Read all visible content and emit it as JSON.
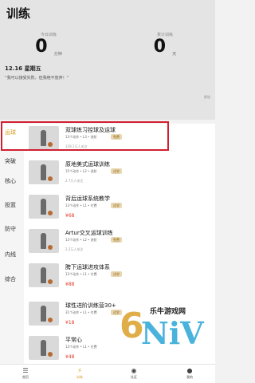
{
  "header": {
    "title": "训练"
  },
  "stats": {
    "today": {
      "label": "今日训练",
      "value": "0",
      "unit": "分钟"
    },
    "total": {
      "label": "累计训练",
      "value": "0",
      "unit": "天"
    }
  },
  "date": "12.16 星期五",
  "quote": "“我可以接受失败，但我绝不放弃！”",
  "lock_text": "解锁",
  "sidebar": {
    "items": [
      {
        "label": "运球",
        "active": true
      },
      {
        "label": "突破"
      },
      {
        "label": "核心"
      },
      {
        "label": "投篮"
      },
      {
        "label": "防守"
      },
      {
        "label": "内线"
      },
      {
        "label": "综合"
      }
    ]
  },
  "courses": [
    {
      "title": "双球练习控球及运球",
      "meta": "13个动作 • L3 • 进阶",
      "tag": "免费",
      "extra": "129.1万人关注"
    },
    {
      "title": "原地美式运球训练",
      "meta": "15个动作 • L2 • 进阶",
      "tag": "试学",
      "extra": "2.7万人关注"
    },
    {
      "title": "背后运球系统教学",
      "meta": "13个动作 • L1 • 付费",
      "tag": "试学",
      "extra": "¥68"
    },
    {
      "title": "Artur交叉运球训练",
      "meta": "13个动作 • L2 • 进阶",
      "tag": "免费",
      "extra": "2.2万人关注"
    },
    {
      "title": "胯下运球进攻体系",
      "meta": "13个动作 • L1 • 付费",
      "tag": "试学",
      "extra": "¥88"
    },
    {
      "title": "球性进阶训练营30+",
      "meta": "31个动作 • L1 • 付费",
      "tag": "试学",
      "extra": "¥18"
    },
    {
      "title": "平常心",
      "meta": "13个动作 • L1 • 付费",
      "tag": "",
      "extra": "¥48"
    }
  ],
  "tabbar": [
    {
      "label": "首页",
      "icon": "home-icon"
    },
    {
      "label": "训练",
      "icon": "lightning-icon",
      "active": true
    },
    {
      "label": "社区",
      "icon": "eye-icon"
    },
    {
      "label": "我的",
      "icon": "person-icon"
    }
  ],
  "watermark": {
    "text": "乐牛游戏网",
    "logo": "6NiV.com"
  },
  "colors": {
    "accent": "#d6a12a",
    "highlight": "#d11f2f",
    "price": "#e23a2a"
  }
}
